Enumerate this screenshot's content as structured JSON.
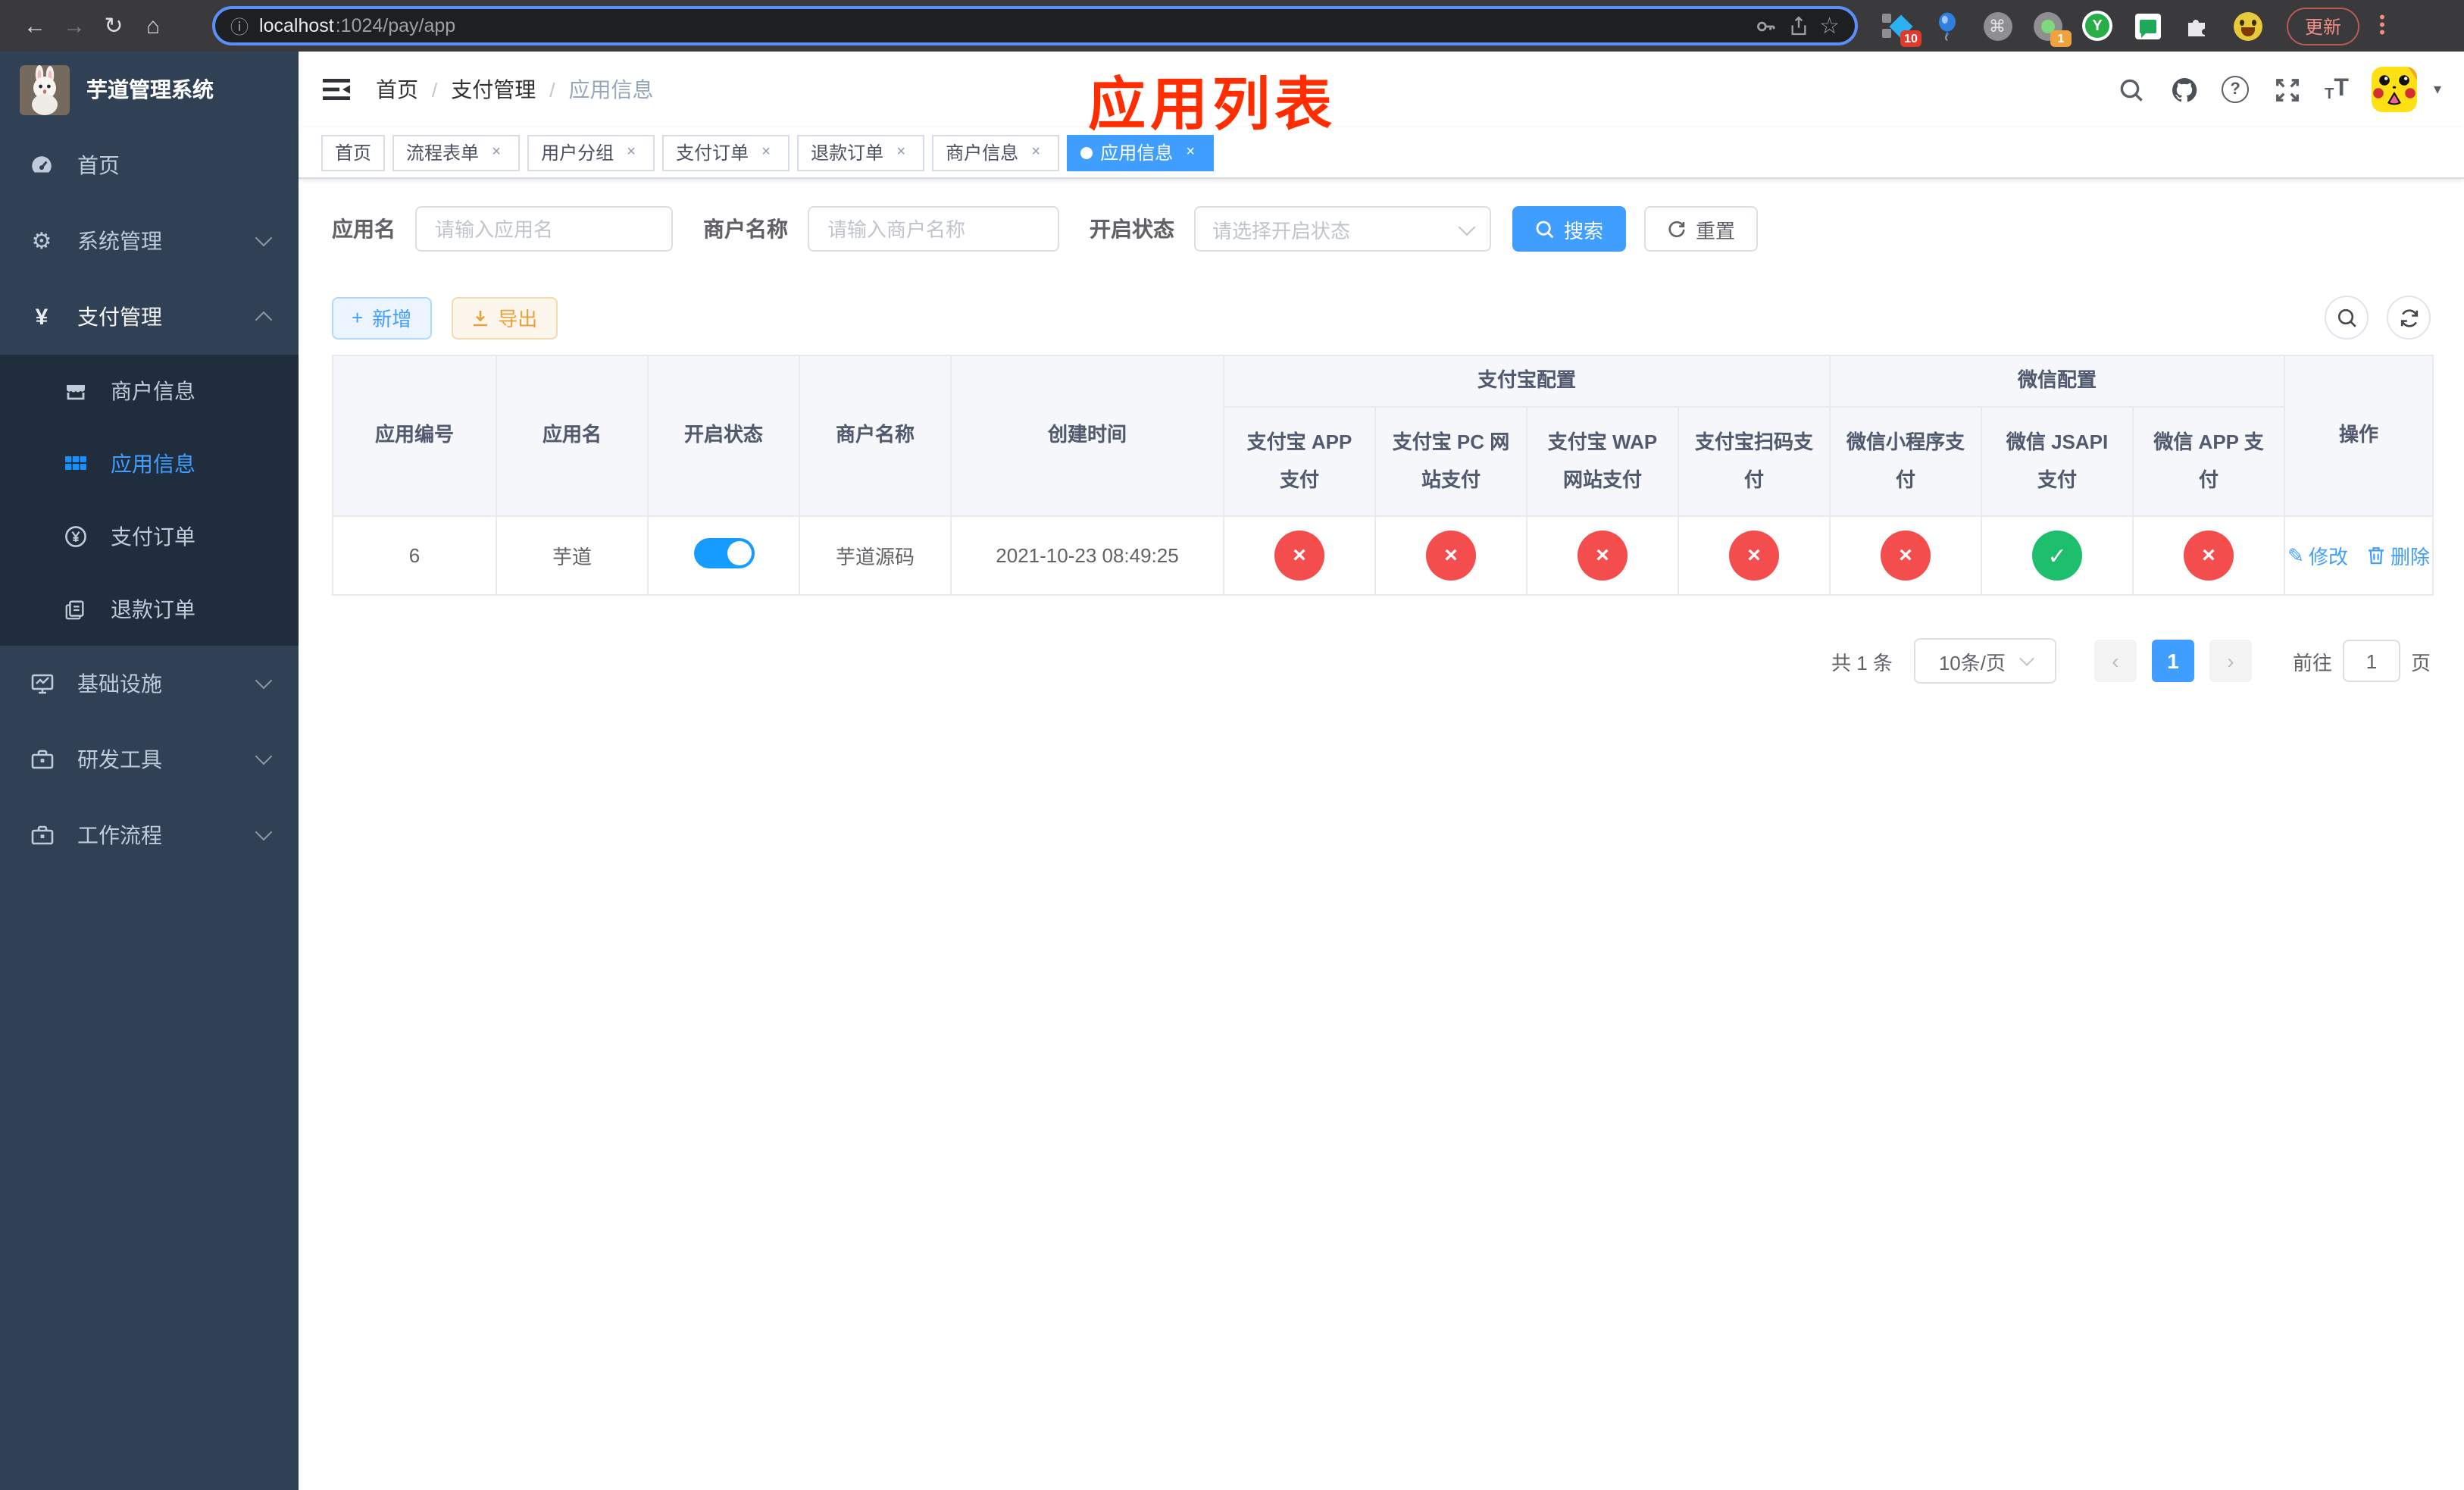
{
  "browser": {
    "url": {
      "host": "localhost",
      "path": ":1024/pay/app"
    },
    "update_label": "更新",
    "badges": {
      "pin": "10",
      "proxy": "1"
    }
  },
  "sidebar": {
    "title": "芋道管理系统",
    "menu": [
      {
        "label": "首页"
      },
      {
        "label": "系统管理"
      },
      {
        "label": "支付管理"
      },
      {
        "label": "基础设施"
      },
      {
        "label": "研发工具"
      },
      {
        "label": "工作流程"
      }
    ],
    "submenu": [
      {
        "label": "商户信息"
      },
      {
        "label": "应用信息"
      },
      {
        "label": "支付订单"
      },
      {
        "label": "退款订单"
      }
    ]
  },
  "navbar": {
    "breadcrumb": [
      "首页",
      "支付管理",
      "应用信息"
    ],
    "annotation": "应用列表"
  },
  "tabs": [
    {
      "label": "首页",
      "closable": false,
      "active": false
    },
    {
      "label": "流程表单",
      "closable": true,
      "active": false
    },
    {
      "label": "用户分组",
      "closable": true,
      "active": false
    },
    {
      "label": "支付订单",
      "closable": true,
      "active": false
    },
    {
      "label": "退款订单",
      "closable": true,
      "active": false
    },
    {
      "label": "商户信息",
      "closable": true,
      "active": false
    },
    {
      "label": "应用信息",
      "closable": true,
      "active": true
    }
  ],
  "filters": {
    "app_name": {
      "label": "应用名",
      "placeholder": "请输入应用名",
      "value": ""
    },
    "merchant_name": {
      "label": "商户名称",
      "placeholder": "请输入商户名称",
      "value": ""
    },
    "status": {
      "label": "开启状态",
      "placeholder": "请选择开启状态",
      "value": ""
    },
    "search": "搜索",
    "reset": "重置"
  },
  "toolbar": {
    "add": "新增",
    "export": "导出"
  },
  "table": {
    "columns": {
      "app_id": "应用编号",
      "app_name": "应用名",
      "status": "开启状态",
      "merchant": "商户名称",
      "created": "创建时间",
      "op": "操作"
    },
    "groups": {
      "alipay": "支付宝配置",
      "wechat": "微信配置"
    },
    "channel_columns": [
      "支付宝 APP 支付",
      "支付宝 PC 网站支付",
      "支付宝 WAP 网站支付",
      "支付宝扫码支付",
      "微信小程序支付",
      "微信 JSAPI 支付",
      "微信 APP 支付"
    ],
    "row": {
      "app_id": "6",
      "app_name": "芋道",
      "status_on": true,
      "merchant": "芋道源码",
      "created": "2021-10-23 08:49:25",
      "channels": [
        "fail",
        "fail",
        "fail",
        "fail",
        "fail",
        "pass",
        "fail"
      ],
      "edit": "修改",
      "delete": "删除"
    }
  },
  "pagination": {
    "total": "共 1 条",
    "page_size": "10条/页",
    "page": "1",
    "goto_label": "前往",
    "goto_value": "1",
    "goto_suffix": "页"
  },
  "icons": {
    "back": "←",
    "forward": "→",
    "reload": "↻",
    "home": "⌂",
    "info": "ⓘ",
    "star": "☆",
    "command": "⌘",
    "close": "×",
    "check": "✓",
    "cross": "×",
    "caret": "▾",
    "chevron_left": "‹",
    "chevron_right": "›",
    "gear": "⚙",
    "yen": "¥",
    "plus": "+",
    "edit_pen": "✎",
    "question": "?",
    "letter_t_small": "T",
    "letter_t_big": "T",
    "letter_y": "Y",
    "kebab_dot": "•"
  },
  "colors": {
    "accent": "#409eff",
    "danger": "#f34d4d",
    "success": "#1dbe6c",
    "annotation": "#ff2d00",
    "sidebar": "#304156"
  }
}
